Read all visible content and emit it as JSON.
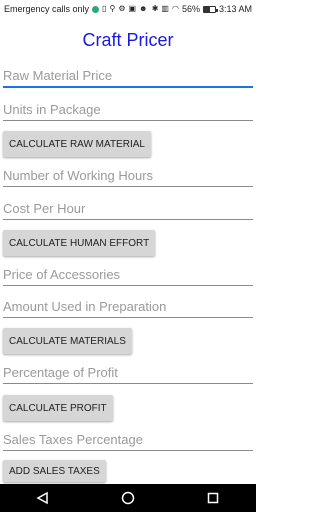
{
  "status_bar": {
    "carrier_text": "Emergency calls only",
    "battery_percent": "56%",
    "time": "3:13 AM",
    "battery_level": 0.56,
    "notification_dot_color": "#2aa876"
  },
  "app": {
    "title": "Craft Pricer",
    "title_color": "#1a1adc"
  },
  "form": {
    "raw_material_price": {
      "placeholder": "Raw Material Price",
      "value": ""
    },
    "units_in_package": {
      "placeholder": "Units in Package",
      "value": ""
    },
    "calc_raw_material_label": "CALCULATE RAW MATERIAL",
    "working_hours": {
      "placeholder": "Number of Working Hours",
      "value": ""
    },
    "cost_per_hour": {
      "placeholder": "Cost Per Hour",
      "value": ""
    },
    "calc_human_effort_label": "CALCULATE HUMAN EFFORT",
    "price_of_accessories": {
      "placeholder": "Price of Accessories",
      "value": ""
    },
    "amount_used": {
      "placeholder": "Amount Used in Preparation",
      "value": ""
    },
    "calc_materials_label": "CALCULATE MATERIALS",
    "percentage_of_profit": {
      "placeholder": "Percentage of Profit",
      "value": ""
    },
    "calc_profit_label": "CALCULATE PROFIT",
    "sales_taxes": {
      "placeholder": "Sales Taxes Percentage",
      "value": ""
    },
    "add_sales_taxes_label": "ADD SALES TAXES"
  },
  "nav": {
    "back_icon": "back-triangle-icon",
    "home_icon": "home-circle-icon",
    "recents_icon": "recents-square-icon"
  }
}
